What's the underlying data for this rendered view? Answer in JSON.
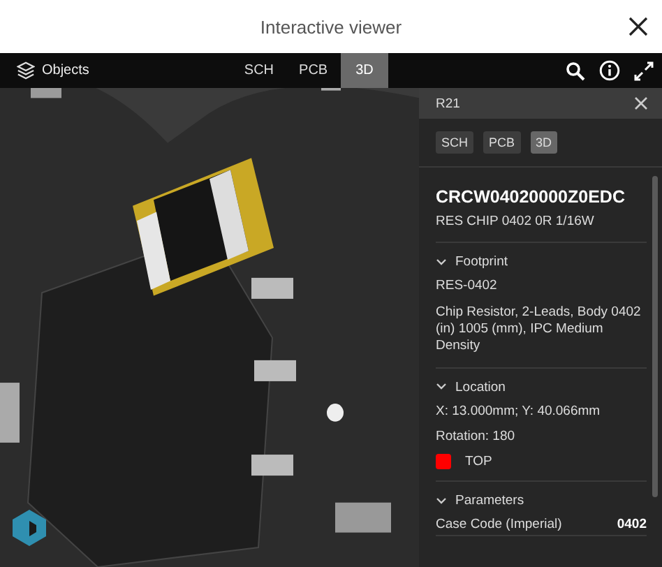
{
  "window": {
    "title": "Interactive viewer"
  },
  "toolbar": {
    "objects_label": "Objects",
    "tabs": [
      {
        "label": "SCH",
        "selected": false
      },
      {
        "label": "PCB",
        "selected": false
      },
      {
        "label": "3D",
        "selected": true
      }
    ]
  },
  "panel": {
    "title": "R21",
    "tabs": [
      {
        "label": "SCH",
        "selected": false
      },
      {
        "label": "PCB",
        "selected": false
      },
      {
        "label": "3D",
        "selected": true
      }
    ],
    "part_number": "CRCW04020000Z0EDC",
    "description": "RES CHIP 0402 0R 1/16W",
    "sections": [
      {
        "kind": "text",
        "title": "Footprint",
        "expanded": true,
        "lines": [
          "RES-0402",
          "Chip Resistor, 2-Leads, Body 0402 (in) 1005 (mm), IPC Medium Density"
        ]
      },
      {
        "kind": "location",
        "title": "Location",
        "expanded": true,
        "lines": [
          "X: 13.000mm; Y: 40.066mm",
          "Rotation: 180"
        ],
        "layer": {
          "label": "TOP",
          "color": "#ff0000"
        }
      },
      {
        "kind": "params",
        "title": "Parameters",
        "expanded": true,
        "rows": [
          {
            "name": "Case Code (Imperial)",
            "value": "0402"
          }
        ]
      }
    ]
  }
}
